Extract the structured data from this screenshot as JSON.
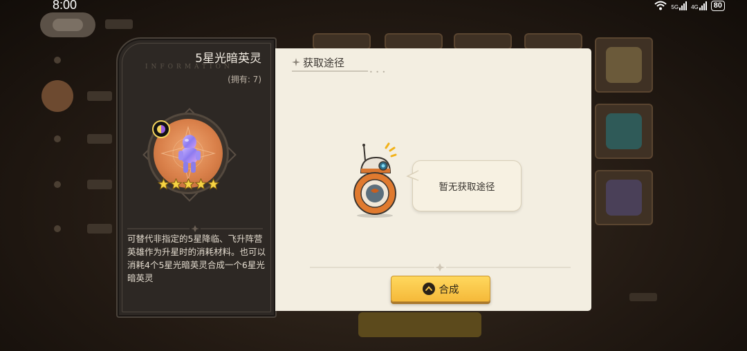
{
  "status_bar": {
    "time": "8:00",
    "network_1": "5G",
    "network_2": "4G",
    "battery": "80"
  },
  "hero": {
    "title": "5星光暗英灵",
    "watermark": "INFORMATION",
    "owned_label": "(拥有: 7)",
    "stars": 5,
    "description": "可替代非指定的5星降临、飞升阵营英雄作为升星时的消耗材料。也可以消耗4个5星光暗英灵合成一个6星光暗英灵"
  },
  "sources": {
    "header": "获取途径",
    "empty_message": "暂无获取途径"
  },
  "actions": {
    "compose_label": "合成"
  },
  "colors": {
    "panel_dark": "#2d2824",
    "panel_light": "#f3eee1",
    "button_gold": "#f5b93a",
    "portrait_orange": "#d9804a",
    "star_yellow": "#f7d443"
  },
  "icons": {
    "element_badge": "light-dark-element-icon",
    "header_spark": "spark-icon",
    "compose": "chevron-up-circle-icon",
    "mascot": "robot-mascot-icon"
  }
}
